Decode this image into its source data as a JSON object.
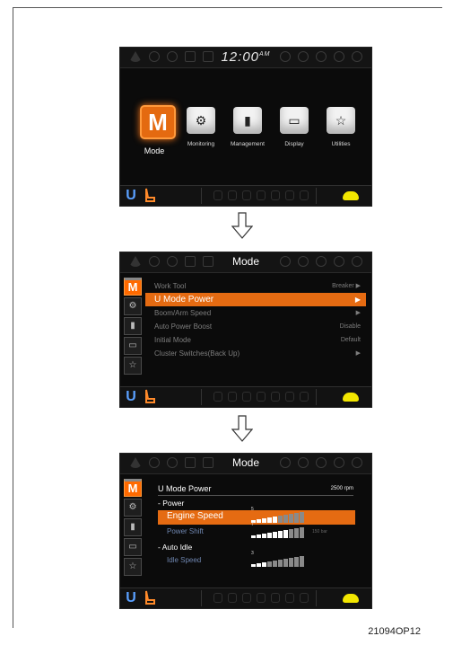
{
  "screen1": {
    "clock": "12:00",
    "clock_suffix": "AM",
    "menu": [
      {
        "label": "Mode",
        "glyph": "M",
        "icon": "mode-icon",
        "selected": true
      },
      {
        "label": "Monitoring",
        "glyph": "⚙",
        "icon": "gear-icon"
      },
      {
        "label": "Management",
        "glyph": "▮",
        "icon": "person-icon"
      },
      {
        "label": "Display",
        "glyph": "▭",
        "icon": "tv-icon"
      },
      {
        "label": "Utilities",
        "glyph": "☆",
        "icon": "star-icon"
      }
    ]
  },
  "screen2": {
    "title": "Mode",
    "items": [
      {
        "label": "Work Tool",
        "value": "Breaker ▶"
      },
      {
        "label": "U Mode Power",
        "value": "▶",
        "selected": true
      },
      {
        "label": "Boom/Arm Speed",
        "value": "▶"
      },
      {
        "label": "Auto Power Boost",
        "value": "Disable"
      },
      {
        "label": "Initial Mode",
        "value": "Default"
      },
      {
        "label": "Cluster Switches(Back Up)",
        "value": "▶"
      }
    ]
  },
  "screen3": {
    "title": "Mode",
    "panel_title": "U Mode Power",
    "rpm": "2500 rpm",
    "section_power": "- Power",
    "engine_speed": {
      "label": "Engine Speed",
      "level": "5",
      "level_fraction": 0.5
    },
    "power_shift": {
      "label": "Power Shift",
      "level": "7",
      "extra": "150 bar",
      "level_fraction": 0.7
    },
    "section_auto_idle": "- Auto Idle",
    "idle_speed": {
      "label": "Idle Speed",
      "level": "3",
      "level_fraction": 0.3
    }
  },
  "sidebar": [
    "M",
    "⚙",
    "▮",
    "▭",
    "☆"
  ],
  "bottom": {
    "mode_letter": "U"
  },
  "caption": "21094OP12",
  "colors": {
    "accent": "#e56b12",
    "screen_bg": "#0b0b0b",
    "mode_u": "#5aa0ff",
    "turtle": "#f2e600"
  }
}
